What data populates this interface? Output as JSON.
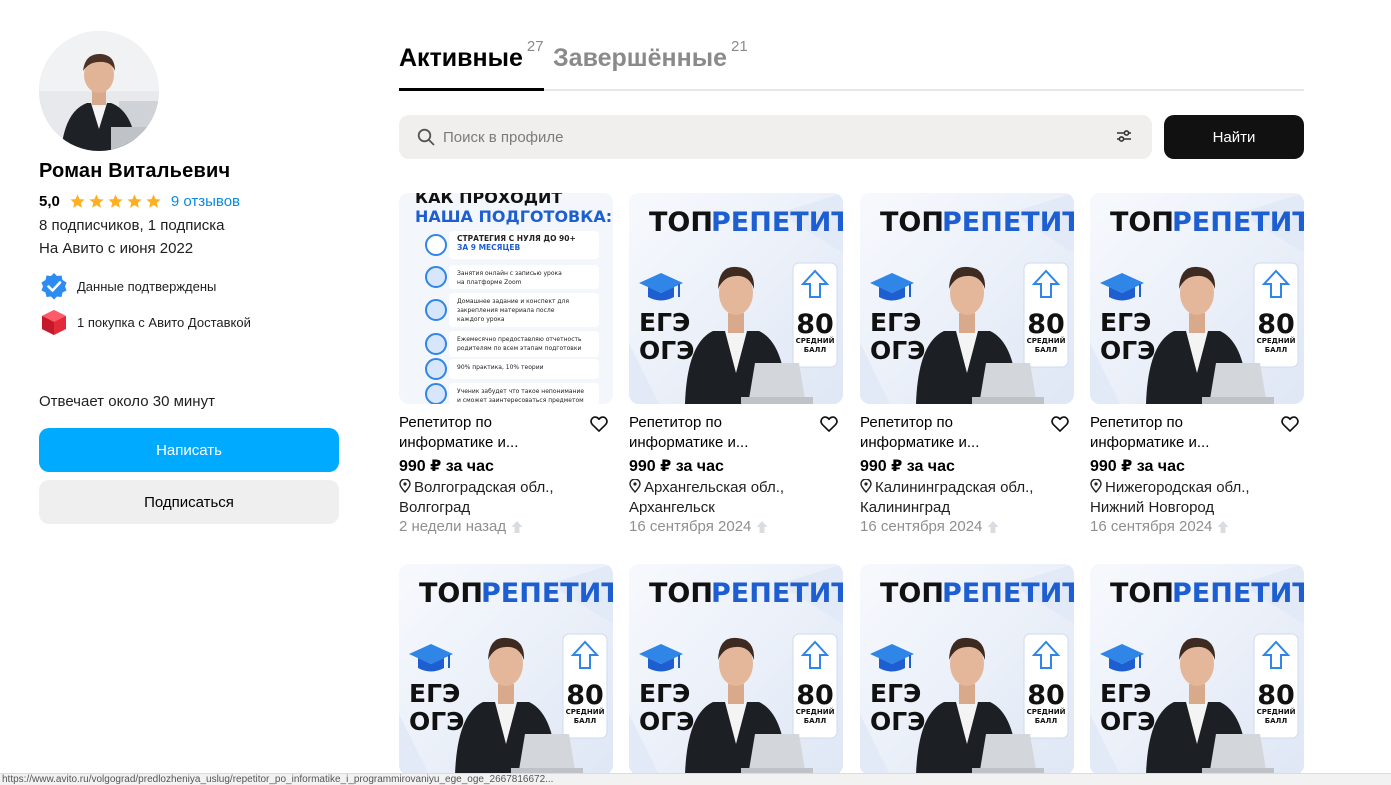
{
  "profile": {
    "name": "Роман Витальевич",
    "rating": "5,0",
    "stars": 5,
    "reviews": "9 отзывов",
    "subscribers": "8 подписчиков, 1 подписка",
    "since": "На Авито с июня 2022",
    "badges": [
      {
        "icon": "verified-check-icon",
        "text": "Данные подтверждены"
      },
      {
        "icon": "delivery-box-icon",
        "text": "1 покупка с Авито Доставкой"
      }
    ],
    "responds": "Отвечает около 30 минут",
    "write_label": "Написать",
    "subscribe_label": "Подписаться"
  },
  "tabs": [
    {
      "label": "Активные",
      "count": "27",
      "active": true
    },
    {
      "label": "Завершённые",
      "count": "21",
      "active": false
    }
  ],
  "search": {
    "placeholder": "Поиск в профиле",
    "button_label": "Найти"
  },
  "listings": [
    {
      "title": "Репетитор по информатике и...",
      "price": "990 ₽ за час",
      "location": "Волгоградская обл., Волгоград",
      "date": "2 недели назад",
      "image": "how-we-prepare"
    },
    {
      "title": "Репетитор по информатике и...",
      "price": "990 ₽ за час",
      "location": "Архангельская обл., Архангельск",
      "date": "16 сентября 2024",
      "image": "top-tutor"
    },
    {
      "title": "Репетитор по информатике и...",
      "price": "990 ₽ за час",
      "location": "Калининградская обл., Калининград",
      "date": "16 сентября 2024",
      "image": "top-tutor"
    },
    {
      "title": "Репетитор по информатике и...",
      "price": "990 ₽ за час",
      "location": "Нижегородская обл., Нижний Новгород",
      "date": "16 сентября 2024",
      "image": "top-tutor"
    },
    {
      "image": "top-tutor"
    },
    {
      "image": "top-tutor"
    },
    {
      "image": "top-tutor"
    },
    {
      "image": "top-tutor"
    }
  ],
  "poster_how": {
    "title1": "КАК ПРОХОДИТ",
    "title2": "НАША ПОДГОТОВКА:",
    "items": [
      "СТРАТЕГИЯ С НУЛЯ ДО 90+",
      "ЗА 9 МЕСЯЦЕВ",
      "Занятия онлайн с записью урока",
      "на платформе Zoom",
      "Домашнее задание и конспект для",
      "закрепления материала после",
      "каждого урока",
      "Ежемесячно предоставляю отчетность",
      "родителям по всем этапам подготовки",
      "90% практика, 10% теории",
      "Ученик забудет что такое непонимание",
      "и сможет заинтересоваться предметом"
    ]
  },
  "poster_top": {
    "top": "ТОП",
    "tutor": "РЕПЕТИТОР",
    "ege": "ЕГЭ",
    "oge": "ОГЭ",
    "score": "80",
    "score_l1": "СРЕДНИЙ",
    "score_l2": "БАЛЛ"
  },
  "colors": {
    "accent": "#00aaff",
    "link": "#0a8adf",
    "star": "#ffb021",
    "poster_blue": "#1d5fd1"
  },
  "statusbar": "https://www.avito.ru/volgograd/predlozheniya_uslug/repetitor_po_informatike_i_programmirovaniyu_ege_oge_2667816672..."
}
